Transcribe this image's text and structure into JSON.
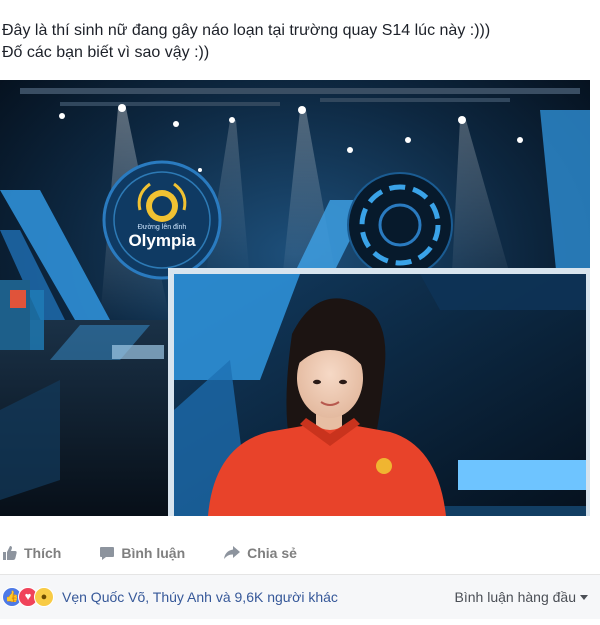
{
  "post": {
    "line1": "Đây là thí sinh nữ đang gây náo loạn tại trường quay S14 lúc này :)))",
    "line2": "Đố các bạn biết vì sao vậy :))"
  },
  "photo": {
    "logo_text": "Olympia",
    "logo_subtext": "Đường lên đỉnh"
  },
  "actions": [
    {
      "label": "Thích",
      "icon": "thumbs-up-icon"
    },
    {
      "label": "Bình luận",
      "icon": "comment-icon"
    },
    {
      "label": "Chia sẻ",
      "icon": "share-icon"
    }
  ],
  "reactions": {
    "icons": [
      "like-reaction-icon",
      "love-reaction-icon",
      "wow-reaction-icon"
    ],
    "names": "Vẹn Quốc Võ, Thúy Anh và 9,6K người khác",
    "sort_label": "Bình luận hàng đầu"
  },
  "colors": {
    "action_text": "#7f7f7f",
    "link_blue": "#365899",
    "bar_bg": "#f6f7f9",
    "shirt": "#e8432a"
  }
}
